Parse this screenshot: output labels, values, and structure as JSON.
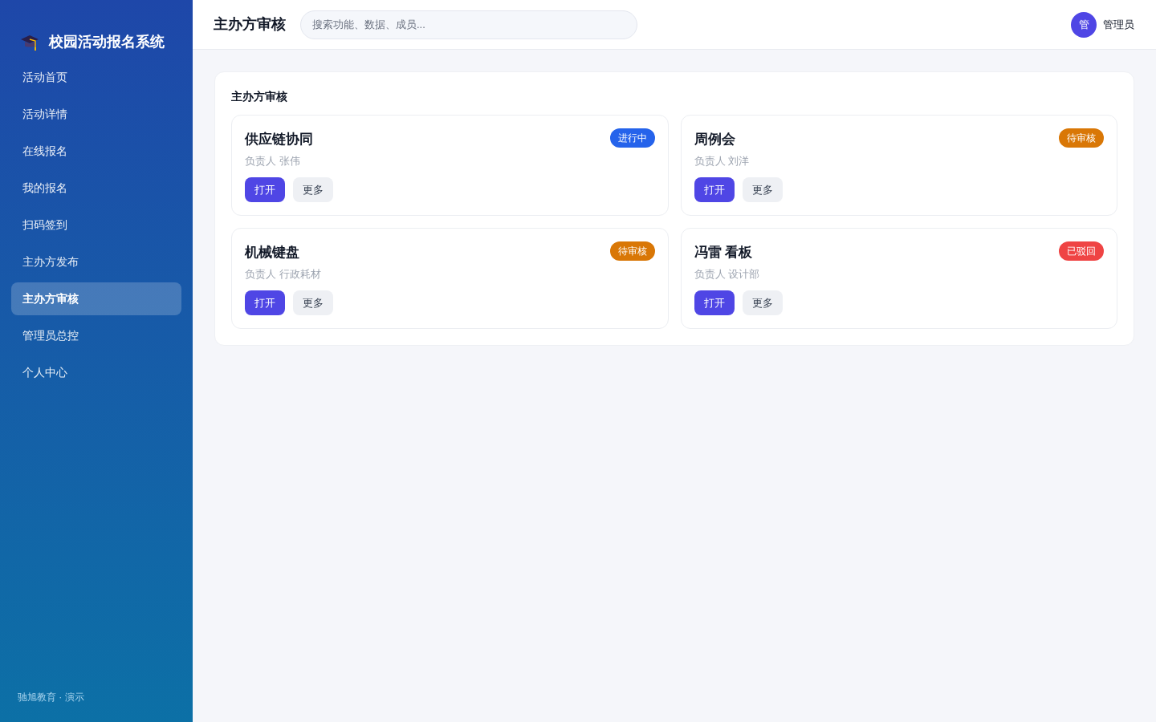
{
  "sidebar": {
    "brand": "校园活动报名系统",
    "items": [
      {
        "label": "活动首页",
        "selected": false
      },
      {
        "label": "活动详情",
        "selected": false
      },
      {
        "label": "在线报名",
        "selected": false
      },
      {
        "label": "我的报名",
        "selected": false
      },
      {
        "label": "扫码签到",
        "selected": false
      },
      {
        "label": "主办方发布",
        "selected": false
      },
      {
        "label": "主办方审核",
        "selected": true
      },
      {
        "label": "管理员总控",
        "selected": false
      },
      {
        "label": "个人中心",
        "selected": false
      }
    ],
    "footer": "驰旭教育 · 演示"
  },
  "header": {
    "title": "主办方审核",
    "search": {
      "placeholder": "搜索功能、数据、成员..."
    },
    "user": {
      "avatar": "管",
      "name": "管理员"
    }
  },
  "panel": {
    "title": "主办方审核",
    "cards": [
      {
        "title": "供应链协同",
        "owner": "负责人 张伟",
        "badge": {
          "label": "进行中",
          "color": "#2563eb"
        },
        "buttons": [
          {
            "label": "打开",
            "kind": "primary"
          },
          {
            "label": "更多",
            "kind": "secondary"
          }
        ]
      },
      {
        "title": "周例会",
        "owner": "负责人 刘洋",
        "badge": {
          "label": "待审核",
          "color": "#d97706"
        },
        "buttons": [
          {
            "label": "打开",
            "kind": "primary"
          },
          {
            "label": "更多",
            "kind": "secondary"
          }
        ]
      },
      {
        "title": "机械键盘",
        "owner": "负责人 行政耗材",
        "badge": {
          "label": "待审核",
          "color": "#d97706"
        },
        "buttons": [
          {
            "label": "打开",
            "kind": "primary"
          },
          {
            "label": "更多",
            "kind": "secondary"
          }
        ]
      },
      {
        "title": "冯雷 看板",
        "owner": "负责人 设计部",
        "badge": {
          "label": "已驳回",
          "color": "#ef4444"
        },
        "buttons": [
          {
            "label": "打开",
            "kind": "primary"
          },
          {
            "label": "更多",
            "kind": "secondary"
          }
        ]
      }
    ]
  }
}
